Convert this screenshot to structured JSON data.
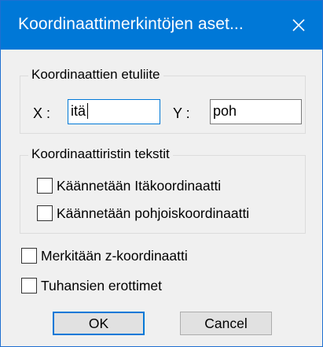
{
  "window": {
    "title": "Koordinaattimerkintöjen aset...",
    "close_glyph": "close-icon"
  },
  "prefix_group": {
    "title": "Koordinaattien etuliite",
    "x_label": "X :",
    "x_value": "itä",
    "y_label": "Y :",
    "y_value": "poh"
  },
  "grid_text_group": {
    "title": "Koordinaattiristin tekstit",
    "items": [
      {
        "label": "Käännetään Itäkoordinaatti",
        "checked": false
      },
      {
        "label": "Käännetään pohjoiskoordinaatti",
        "checked": false
      }
    ]
  },
  "options": [
    {
      "label": "Merkitään z-koordinaatti",
      "checked": false
    },
    {
      "label": "Tuhansien erottimet",
      "checked": false
    }
  ],
  "buttons": {
    "ok_label": "OK",
    "cancel_label": "Cancel"
  },
  "colors": {
    "titlebar": "#0078d7",
    "dialog_bg": "#f0f0f0",
    "focus_border": "#0078d7"
  }
}
